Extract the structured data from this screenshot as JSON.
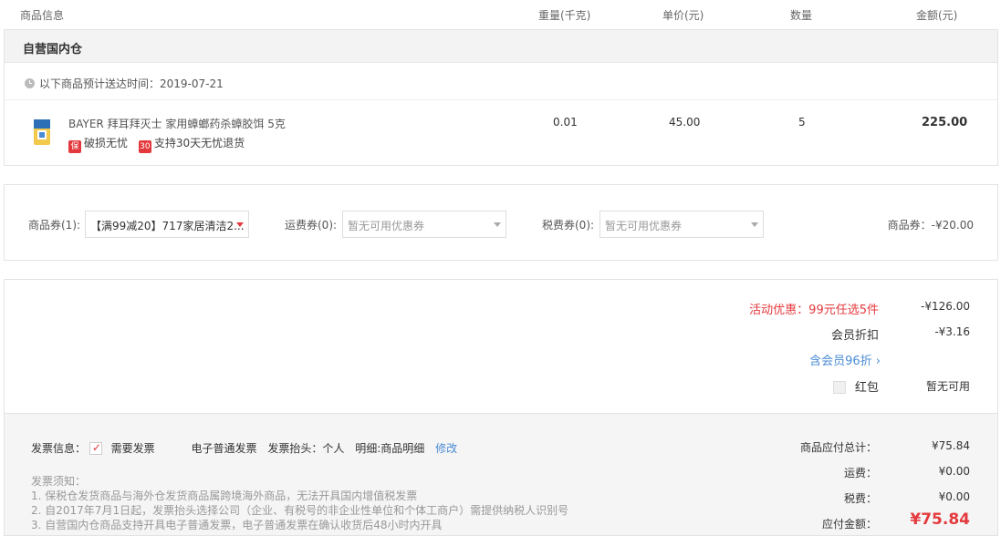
{
  "header": {
    "product_info": "商品信息",
    "weight": "重量(千克)",
    "unit_price": "单价(元)",
    "quantity": "数量",
    "amount": "金额(元)"
  },
  "warehouse": {
    "title": "自营国内仓",
    "delivery_text": "以下商品预计送达时间：2019-07-21"
  },
  "product": {
    "name": "BAYER 拜耳拜灭士 家用蟑螂药杀蟑胶饵 5克",
    "tag1_icon": "保",
    "tag1_label": "破损无忧",
    "tag2_icon": "30",
    "tag2_label": "支持30天无忧退货",
    "weight": "0.01",
    "price": "45.00",
    "qty": "5",
    "amount": "225.00"
  },
  "coupons": {
    "goods_label": "商品券(1):",
    "goods_value": "【满99减20】717家居清洁2...",
    "shipping_label": "运费券(0):",
    "shipping_value": "暂无可用优惠券",
    "tax_label": "税费券(0):",
    "tax_value": "暂无可用优惠券",
    "summary": "商品券：-¥20.00"
  },
  "discounts": {
    "activity_label": "活动优惠：99元任选5件",
    "activity_value": "-¥126.00",
    "member_label": "会员折扣",
    "member_value": "-¥3.16",
    "member_link": "含会员96折 ›",
    "redpacket_label": "红包",
    "redpacket_value": "暂无可用"
  },
  "invoice": {
    "label": "发票信息：",
    "need_label": "需要发票",
    "type": "电子普通发票",
    "title": "发票抬头：个人",
    "detail": "明细:商品明细",
    "edit": "修改",
    "notes_title": "发票须知：",
    "notes": [
      "1. 保税仓发货商品与海外仓发货商品属跨境海外商品，无法开具国内增值税发票",
      "2. 自2017年7月1日起，发票抬头选择公司（企业、有税号的非企业性单位和个体工商户）需提供纳税人识别号",
      "3. 自营国内仓商品支持开具电子普通发票，电子普通发票在确认收货后48小时内开具"
    ]
  },
  "totals": {
    "goods_total_label": "商品应付总计：",
    "goods_total": "¥75.84",
    "shipping_label": "运费：",
    "shipping": "¥0.00",
    "tax_label": "税费：",
    "tax": "¥0.00",
    "payable_label": "应付金额：",
    "payable": "¥75.84"
  },
  "colors": {
    "accent_red": "#e4393c",
    "link_blue": "#4a8bd5"
  }
}
